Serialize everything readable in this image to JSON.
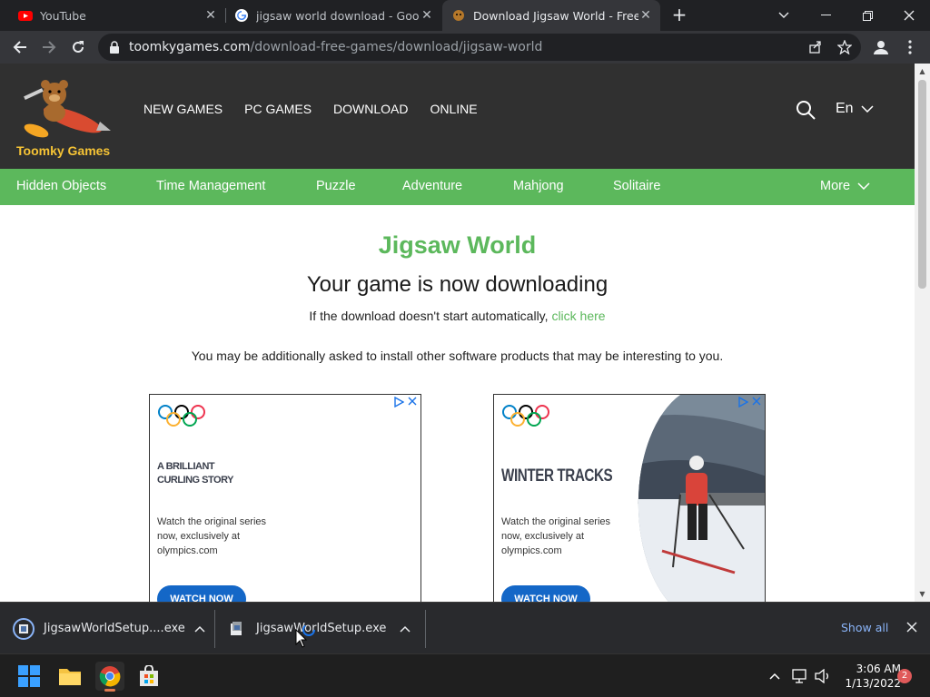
{
  "browser": {
    "tabs": [
      {
        "title": "YouTube",
        "active": false
      },
      {
        "title": "jigsaw world download - Google",
        "active": false
      },
      {
        "title": "Download Jigsaw World - Free PC",
        "active": true
      }
    ],
    "url_host": "toomkygames.com",
    "url_path": "/download-free-games/download/jigsaw-world"
  },
  "site": {
    "logo_text": "Toomky Games",
    "topnav": [
      "NEW GAMES",
      "PC GAMES",
      "DOWNLOAD",
      "ONLINE"
    ],
    "language": "En",
    "categories": [
      "Hidden Objects",
      "Time Management",
      "Puzzle",
      "Adventure",
      "Mahjong",
      "Solitaire"
    ],
    "more_label": "More"
  },
  "content": {
    "title": "Jigsaw World",
    "subtitle": "Your game is now downloading",
    "hint_text": "If the download doesn't start automatically, ",
    "hint_link": "click here",
    "notice": "You may be additionally asked to install other software products that may be interesting to you."
  },
  "ads": [
    {
      "headline_1": "A BRILLIANT",
      "headline_2": "CURLING STORY",
      "body_1": "Watch the original series",
      "body_2": "now, exclusively at",
      "body_3": "olympics.com",
      "cta": "WATCH NOW"
    },
    {
      "headline_1": "WINTER TRACKS",
      "body_1": "Watch the original series",
      "body_2": "now, exclusively at",
      "body_3": "olympics.com",
      "cta": "WATCH NOW"
    }
  ],
  "downloads": {
    "items": [
      {
        "name": "JigsawWorldSetup....exe"
      },
      {
        "name": "JigsawWorldSetup.exe"
      }
    ],
    "show_all": "Show all"
  },
  "taskbar": {
    "time": "3:06 AM",
    "date": "1/13/2022",
    "notifications": "2"
  },
  "colors": {
    "accent_green": "#5cb85c",
    "header_dark": "#303030",
    "ad_button": "#1467c7"
  }
}
